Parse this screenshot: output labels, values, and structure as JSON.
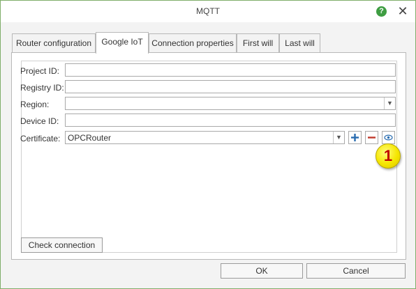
{
  "window": {
    "title": "MQTT"
  },
  "title_buttons": {
    "help": "?",
    "close": "✕"
  },
  "tabs": [
    {
      "label": "Router configuration"
    },
    {
      "label": "Google IoT"
    },
    {
      "label": "Connection properties"
    },
    {
      "label": "First will"
    },
    {
      "label": "Last will"
    }
  ],
  "active_tab": "Google IoT",
  "form": {
    "project_id": {
      "label": "Project ID:",
      "value": ""
    },
    "registry_id": {
      "label": "Registry ID:",
      "value": ""
    },
    "region": {
      "label": "Region:",
      "value": ""
    },
    "device_id": {
      "label": "Device ID:",
      "value": ""
    },
    "certificate": {
      "label": "Certificate:",
      "value": "OPCRouter"
    }
  },
  "certificate_buttons": {
    "add": "plus-icon",
    "remove": "minus-icon",
    "view": "eye-icon"
  },
  "annotation": {
    "number": "1"
  },
  "buttons": {
    "check_connection": "Check connection",
    "ok": "OK",
    "cancel": "Cancel"
  },
  "colors": {
    "accent": "#3e9d42",
    "border": "#7fae6a",
    "remove": "#c0392b",
    "add": "#2a6db0",
    "badge": "#f5e600"
  }
}
